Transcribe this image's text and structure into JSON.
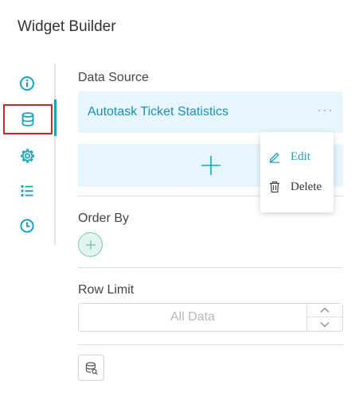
{
  "header": {
    "title": "Widget Builder"
  },
  "nav": {
    "items": [
      {
        "icon": "info-icon"
      },
      {
        "icon": "database-icon",
        "active": true
      },
      {
        "icon": "gear-icon"
      },
      {
        "icon": "list-icon"
      },
      {
        "icon": "clock-icon"
      }
    ],
    "accent": "#1aa3b7",
    "highlight": "#d3222a"
  },
  "data_source": {
    "label": "Data Source",
    "selected": "Autotask Ticket Statistics",
    "more_icon": "more-dots-icon",
    "add_icon": "plus-icon"
  },
  "context_menu": {
    "edit": "Edit",
    "delete": "Delete",
    "edit_color": "#1aa3b7"
  },
  "order_by": {
    "label": "Order By",
    "add_icon": "plus-icon"
  },
  "row_limit": {
    "label": "Row Limit",
    "value": "",
    "placeholder": "All Data"
  },
  "sql_button": {
    "icon": "database-query-icon"
  }
}
